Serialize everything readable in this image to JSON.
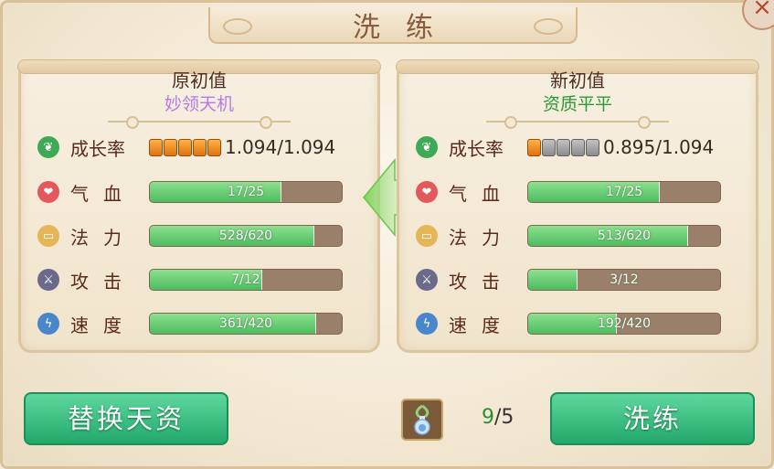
{
  "title": "洗练",
  "left_panel": {
    "heading": "原初值",
    "quality": "妙领天机",
    "growth": {
      "label": "成长率",
      "value": "1.094/1.094",
      "gems_on": 5,
      "gems_total": 5
    },
    "stats": [
      {
        "label": "气血",
        "text": "17/25",
        "fraction": 0.68
      },
      {
        "label": "法力",
        "text": "528/620",
        "fraction": 0.852
      },
      {
        "label": "攻击",
        "text": "7/12",
        "fraction": 0.583
      },
      {
        "label": "速度",
        "text": "361/420",
        "fraction": 0.86
      }
    ]
  },
  "right_panel": {
    "heading": "新初值",
    "quality": "资质平平",
    "growth": {
      "label": "成长率",
      "value": "0.895/1.094",
      "gems_on": 1,
      "gems_total": 5
    },
    "stats": [
      {
        "label": "气血",
        "text": "17/25",
        "fraction": 0.68
      },
      {
        "label": "法力",
        "text": "513/620",
        "fraction": 0.827
      },
      {
        "label": "攻击",
        "text": "3/12",
        "fraction": 0.25
      },
      {
        "label": "速度",
        "text": "192/420",
        "fraction": 0.457
      }
    ]
  },
  "icons": [
    "sprout-icon",
    "heart-icon",
    "scroll-icon",
    "sword-icon",
    "lightning-icon"
  ],
  "buttons": {
    "replace": "替换天资",
    "refine": "洗练"
  },
  "counter": {
    "current": "9",
    "total": "/5"
  },
  "colors": {
    "button_green": "#22a86a",
    "bar_fill": "#4cbc5f",
    "quality_purple": "#b67be6",
    "quality_green": "#2b9a35"
  }
}
